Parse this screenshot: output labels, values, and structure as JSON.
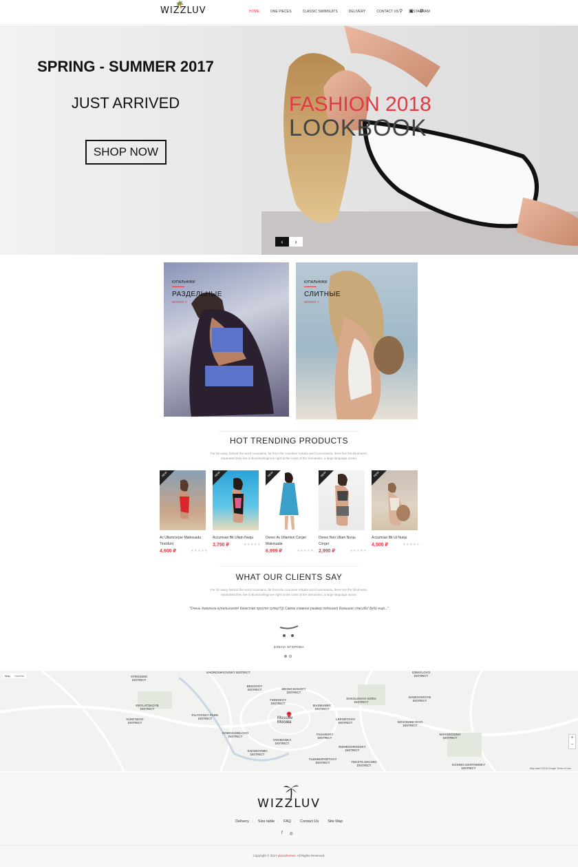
{
  "header": {
    "logo": "WIZZLUV",
    "nav": [
      "HOME",
      "ONE PIECES",
      "CLASSIC SWIMSUITS",
      "DELIVERY",
      "CONTACT US",
      "INSTAGRAM"
    ],
    "icons": [
      "search-icon",
      "cart-icon",
      "settings-icon"
    ]
  },
  "hero": {
    "title": "SPRING - SUMMER 2017",
    "subtitle": "JUST ARRIVED",
    "button": "SHOP NOW",
    "overlay_title": "FASHION 2018",
    "overlay_sub": "LOOKBOOK",
    "accent": "#e23a45"
  },
  "categories": [
    {
      "small": "КУПАЛЬНИКИ",
      "big": "РАЗДЕЛЬНЫЕ",
      "link": "каталог >"
    },
    {
      "small": "КУПАЛЬНИКИ",
      "big": "СЛИТНЫЕ",
      "link": "каталог >"
    }
  ],
  "trending": {
    "title": "HOT TRENDING PRODUCTS",
    "text": "Far far away, behind the word mountains, far from the countries Vokalia and Consonantia, there live the blind texts. Separated they live in Bookmarksgrove right at the coast of the Semantics, a large language ocean."
  },
  "products": [
    {
      "badge": "NEW",
      "name": "Ac Ullamcorper Malesuada Tincidunt",
      "price": "4,600 ₽",
      "stars": "★★★★★"
    },
    {
      "badge": "NEW",
      "name": "Accumsan Bit Ullam Nunju",
      "price": "3,790 ₽",
      "stars": "★★★★★"
    },
    {
      "badge": "NEW",
      "name": "Donec Ac Ullamton Corger Malesuada",
      "price": "6,999 ₽",
      "stars": "★★★★★"
    },
    {
      "badge": "NEW",
      "name": "Donec Non Ullam Nunju Corger",
      "price": "2,990 ₽",
      "stars": "★★★★★"
    },
    {
      "badge": "NEW",
      "name": "Accumsan Bit Ut Nunju",
      "price": "4,500 ₽",
      "stars": "★★★★★"
    }
  ],
  "clients": {
    "title": "WHAT OUR CLIENTS SAY",
    "text": "Far far away, behind the word mountains, far from the countries Vokalia and Consonantia, there live the blind texts. Separated they live in Bookmarksgrove right at the coast of the Semantics, a large language ocean.",
    "quote": "\"Очень довольна купальником! Качество просто супер!!!)) Самое главное размер подошел) Большое спасибо! Буду ещё...\"",
    "author": "ЕЛЕНА ЕГОРОВА"
  },
  "map": {
    "type_map": "Map",
    "type_sat": "Satellite",
    "city": "Moscow",
    "city_ru": "Москва",
    "labels": [
      "KHOROSHYOVSKY DISTRICT",
      "STROGINO DISTRICT",
      "BEGOVOY DISTRICT",
      "MESHCHANSKY DISTRICT",
      "IZMAYLOVO DISTRICT",
      "SOKOLINAYA GORA DISTRICT",
      "IVANOVSKOYE DISTRICT",
      "KRYLATSKOYE DISTRICT",
      "FILYOVSKY PARK DISTRICT",
      "TVERSKOY DISTRICT",
      "BASMANNY DISTRICT",
      "LEFORTOVO DISTRICT",
      "NOVOGIREYEVO DISTRICT",
      "KUNTSEVO DISTRICT",
      "DOROGOMILOVO DISTRICT",
      "YAKIMANKA DISTRICT",
      "TAGANSKY DISTRICT",
      "NOVOKOSINO DISTRICT",
      "KHAMOVNIKI DISTRICT",
      "NIZHEGORODSKY DISTRICT",
      "YUZHNOPORTOVY DISTRICT",
      "TEKSTILSHCHIKI DISTRICT",
      "KOSINO-UKHTOMSKY DISTRICT"
    ],
    "footer": "Map data ©2018 Google   Terms of Use"
  },
  "footer": {
    "logo": "WIZZLUV",
    "links": [
      "Delivery",
      "Size table",
      "FAQ",
      "Contact Us",
      "Site Map"
    ],
    "copyright_pre": "Copyright © 2017",
    "copyright_brand": "plazathemes",
    "copyright_post": ". All Rights Reserved."
  }
}
